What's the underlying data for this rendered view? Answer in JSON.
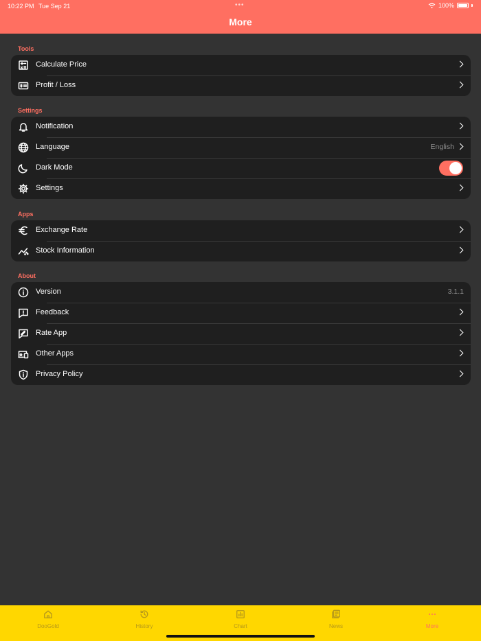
{
  "status_bar": {
    "time": "10:22 PM",
    "date": "Tue Sep 21",
    "battery": "100%"
  },
  "header": {
    "title": "More"
  },
  "sections": {
    "tools": {
      "label": "Tools",
      "items": [
        {
          "label": "Calculate Price",
          "icon": "calculator-icon"
        },
        {
          "label": "Profit / Loss",
          "icon": "money-icon"
        }
      ]
    },
    "settings": {
      "label": "Settings",
      "items": [
        {
          "label": "Notification",
          "icon": "bell-icon"
        },
        {
          "label": "Language",
          "icon": "globe-icon",
          "value": "English"
        },
        {
          "label": "Dark Mode",
          "icon": "moon-icon",
          "toggle": true
        },
        {
          "label": "Settings",
          "icon": "gear-icon"
        }
      ]
    },
    "apps": {
      "label": "Apps",
      "items": [
        {
          "label": "Exchange Rate",
          "icon": "euro-icon"
        },
        {
          "label": "Stock Information",
          "icon": "chart-line-icon"
        }
      ]
    },
    "about": {
      "label": "About",
      "items": [
        {
          "label": "Version",
          "icon": "info-icon",
          "value": "3.1.1"
        },
        {
          "label": "Feedback",
          "icon": "feedback-icon"
        },
        {
          "label": "Rate App",
          "icon": "rate-icon"
        },
        {
          "label": "Other Apps",
          "icon": "devices-icon"
        },
        {
          "label": "Privacy Policy",
          "icon": "shield-icon"
        }
      ]
    }
  },
  "tabbar": {
    "tabs": [
      {
        "label": "DooGold",
        "icon": "home-icon"
      },
      {
        "label": "History",
        "icon": "history-icon"
      },
      {
        "label": "Chart",
        "icon": "chart-icon"
      },
      {
        "label": "News",
        "icon": "news-icon"
      },
      {
        "label": "More",
        "icon": "more-icon",
        "active": true
      }
    ]
  },
  "colors": {
    "accent": "#FF6F61",
    "tabbar": "#FFD700",
    "background": "#333333",
    "card": "#1F1F1F"
  }
}
